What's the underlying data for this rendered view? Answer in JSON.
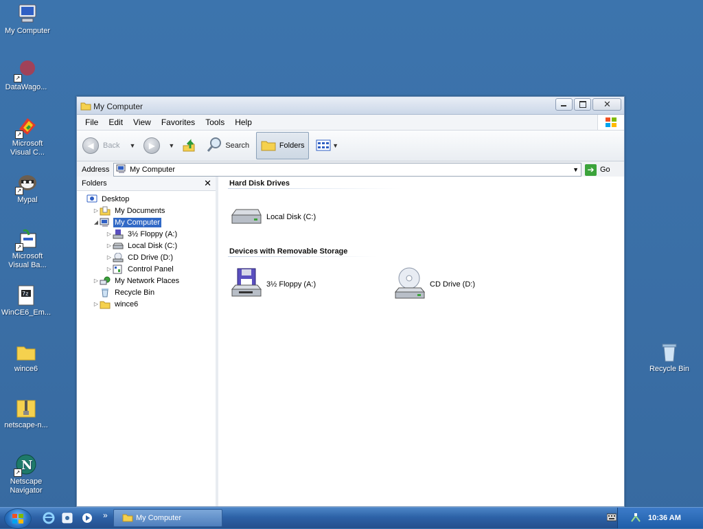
{
  "desktop": {
    "icons": [
      {
        "label": "My Computer",
        "icon": "my-computer-icon"
      },
      {
        "label": "DataWago...",
        "icon": "datawago-icon"
      },
      {
        "label": "Microsoft Visual C...",
        "icon": "visual-c-icon"
      },
      {
        "label": "Mypal",
        "icon": "mypal-icon"
      },
      {
        "label": "Microsoft Visual Ba...",
        "icon": "visual-basic-icon"
      },
      {
        "label": "WinCE6_Em...",
        "icon": "7z-archive-icon"
      },
      {
        "label": "wince6",
        "icon": "folder-icon"
      },
      {
        "label": "netscape-n...",
        "icon": "zip-folder-icon"
      },
      {
        "label": "Netscape Navigator",
        "icon": "netscape-icon"
      },
      {
        "label": "Recycle Bin",
        "icon": "recycle-bin-icon"
      }
    ]
  },
  "window": {
    "title": "My Computer",
    "menu": [
      "File",
      "Edit",
      "View",
      "Favorites",
      "Tools",
      "Help"
    ],
    "toolbar": {
      "back": "Back",
      "search": "Search",
      "folders": "Folders"
    },
    "address": {
      "label": "Address",
      "value": "My Computer",
      "go": "Go"
    },
    "folders_pane": {
      "title": "Folders",
      "tree": [
        {
          "label": "Desktop",
          "level": 0,
          "expander": "",
          "icon": "desktop-icon",
          "selected": false
        },
        {
          "label": "My Documents",
          "level": 1,
          "expander": "▷",
          "icon": "documents-folder-icon",
          "selected": false
        },
        {
          "label": "My Computer",
          "level": 1,
          "expander": "◢",
          "icon": "my-computer-icon",
          "selected": true
        },
        {
          "label": "3½ Floppy (A:)",
          "level": 2,
          "expander": "▷",
          "icon": "floppy-drive-icon",
          "selected": false
        },
        {
          "label": "Local Disk (C:)",
          "level": 2,
          "expander": "▷",
          "icon": "hard-disk-icon",
          "selected": false
        },
        {
          "label": "CD Drive (D:)",
          "level": 2,
          "expander": "▷",
          "icon": "cd-drive-icon",
          "selected": false
        },
        {
          "label": "Control Panel",
          "level": 2,
          "expander": "▷",
          "icon": "control-panel-icon",
          "selected": false
        },
        {
          "label": "My Network Places",
          "level": 1,
          "expander": "▷",
          "icon": "network-places-icon",
          "selected": false
        },
        {
          "label": "Recycle Bin",
          "level": 1,
          "expander": "",
          "icon": "recycle-bin-icon",
          "selected": false
        },
        {
          "label": "wince6",
          "level": 1,
          "expander": "▷",
          "icon": "folder-icon",
          "selected": false
        }
      ]
    },
    "main": {
      "groups": [
        {
          "title": "Hard Disk Drives",
          "items": [
            {
              "label": "Local Disk (C:)",
              "icon": "hard-disk-icon"
            }
          ]
        },
        {
          "title": "Devices with Removable Storage",
          "items": [
            {
              "label": "3½ Floppy (A:)",
              "icon": "floppy-drive-icon"
            },
            {
              "label": "CD Drive (D:)",
              "icon": "cd-drive-icon"
            }
          ]
        }
      ]
    }
  },
  "taskbar": {
    "task": "My Computer",
    "overflow": "»",
    "clock": "10:36 AM"
  }
}
